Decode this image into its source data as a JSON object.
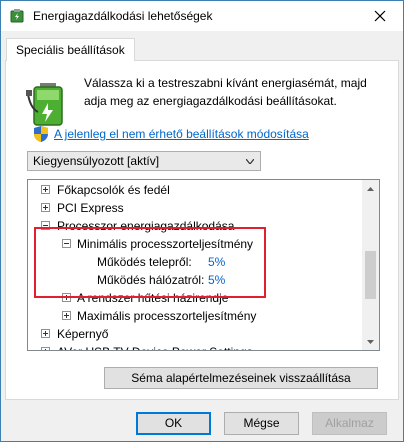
{
  "window": {
    "title": "Energiagazdálkodási lehetőségek"
  },
  "tab": {
    "label": "Speciális beállítások"
  },
  "description": "Válassza ki a testreszabni kívánt energiasémát, majd adja meg az energiagazdálkodási beállításokat.",
  "change_link": "A jelenleg el nem érhető beállítások módosítása",
  "plan_select": {
    "value": "Kiegyensúlyozott [aktív]"
  },
  "tree": {
    "items": [
      {
        "label": "Főkapcsolók és fedél",
        "expander": "plus"
      },
      {
        "label": "PCI Express",
        "expander": "plus"
      },
      {
        "label": "Processzor energiagazdálkodása",
        "expander": "minus"
      },
      {
        "label": "Minimális processzorteljesítmény",
        "expander": "minus"
      },
      {
        "label": "Működés telepről:",
        "value": "5%"
      },
      {
        "label": "Működés hálózatról:",
        "value": "5%"
      },
      {
        "label": "A rendszer hűtési házirendje",
        "expander": "plus"
      },
      {
        "label": "Maximális processzorteljesítmény",
        "expander": "plus"
      },
      {
        "label": "Képernyő",
        "expander": "plus"
      },
      {
        "label": "AVer USB TV Device Power Settings",
        "expander": "plus"
      }
    ]
  },
  "reset_button": "Séma alapértelmezéseinek visszaállítása",
  "buttons": {
    "ok": "OK",
    "cancel": "Mégse",
    "apply": "Alkalmaz"
  },
  "colors": {
    "link": "#0066cc",
    "highlight": "#e0202e",
    "focus": "#0078d7"
  }
}
